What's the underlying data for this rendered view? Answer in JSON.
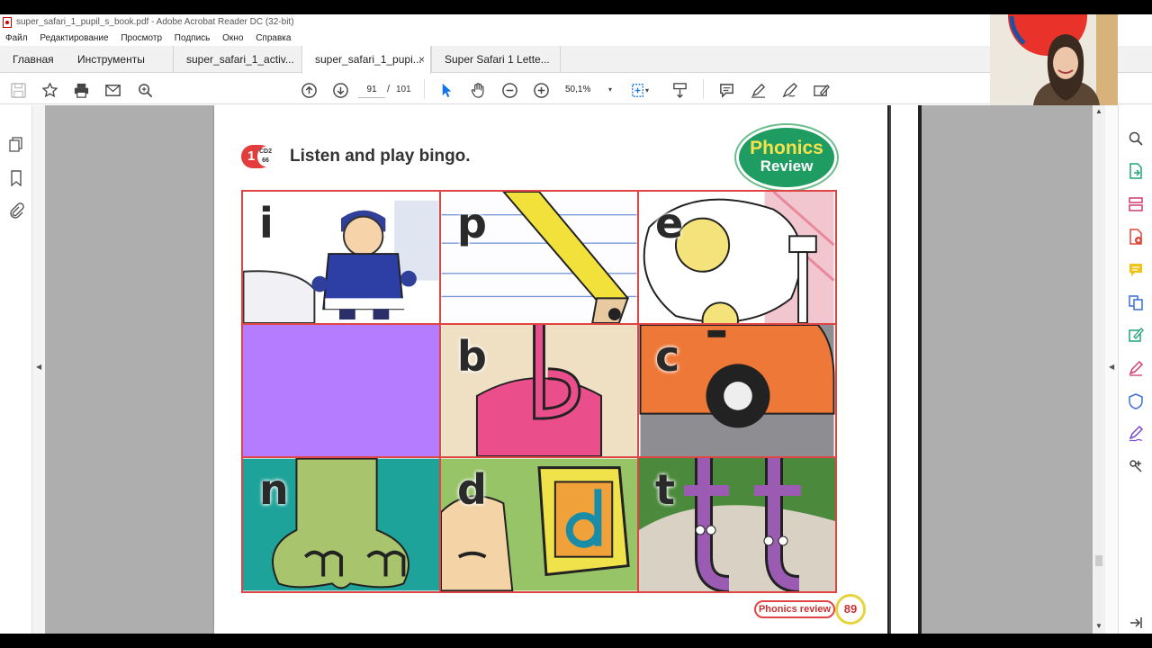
{
  "window": {
    "title": "super_safari_1_pupil_s_book.pdf - Adobe Acrobat Reader DC (32-bit)"
  },
  "menu": [
    "Файл",
    "Редактирование",
    "Просмотр",
    "Подпись",
    "Окно",
    "Справка"
  ],
  "tabs": {
    "home": "Главная",
    "tools": "Инструменты",
    "docs": [
      {
        "label": "super_safari_1_activ..."
      },
      {
        "label": "super_safari_1_pupi..."
      },
      {
        "label": "Super Safari 1 Lette..."
      }
    ],
    "close": "×"
  },
  "toolbar": {
    "page_current": "91",
    "page_sep": "/",
    "page_total": "101",
    "zoom": "50,1%",
    "zoom_caret": "▾"
  },
  "rails": {
    "collapse_left": "◀",
    "collapse_right": "◀",
    "scroll_up": "▲",
    "scroll_down": "▼"
  },
  "doc": {
    "exercise_number": "1",
    "cd_label": "CD2\n66",
    "exercise_title": "Listen and play bingo.",
    "badge_line1": "Phonics",
    "badge_line2": "Review",
    "cells": [
      {
        "letter": "i",
        "bg": "#ffffff"
      },
      {
        "letter": "p",
        "bg": "#f8f8ff"
      },
      {
        "letter": "e",
        "bg": "#ffffff"
      },
      {
        "letter": "",
        "bg": "#b57cff"
      },
      {
        "letter": "b",
        "bg": "#f3e5cf"
      },
      {
        "letter": "c",
        "bg": "#8f8f8f"
      },
      {
        "letter": "n",
        "bg": "#1ea39a"
      },
      {
        "letter": "d",
        "bg": "#97c466"
      },
      {
        "letter": "t",
        "bg": "#d8d0c2"
      }
    ],
    "footer_label": "Phonics review",
    "page_number": "89"
  },
  "colors": {
    "accent_red": "#e04545",
    "badge_green": "#1f9c62",
    "acrobat_blue": "#1473e6"
  }
}
